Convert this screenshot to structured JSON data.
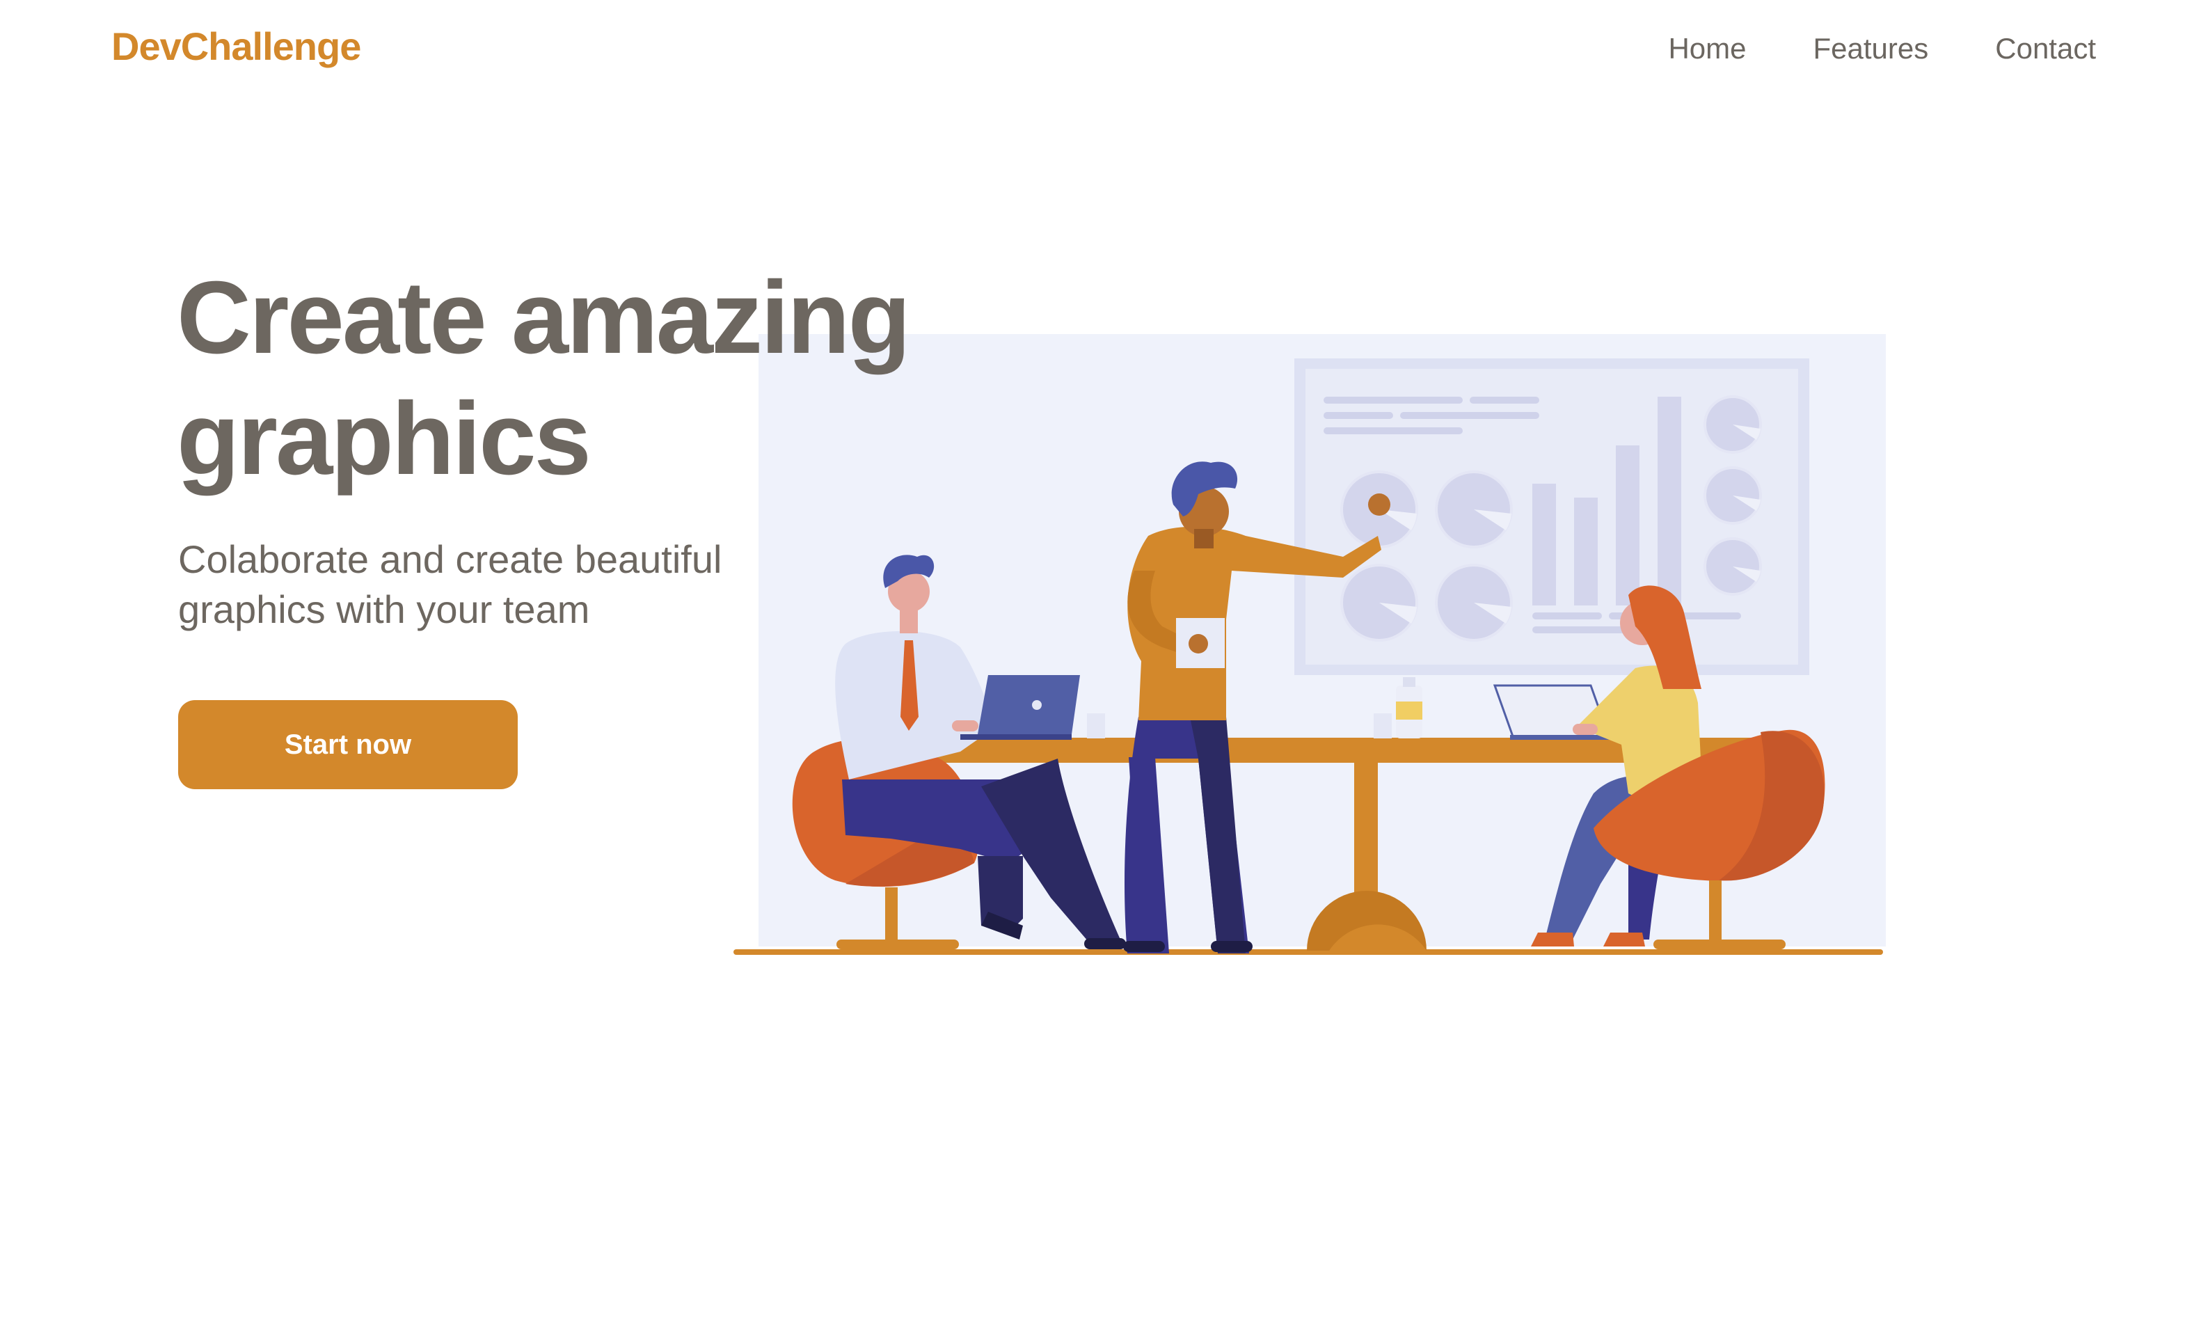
{
  "header": {
    "brand": "DevChallenge",
    "nav": [
      "Home",
      "Features",
      "Contact"
    ]
  },
  "hero": {
    "title": "Create amazing graphics",
    "subtitle": "Colaborate and create beautiful graphics with your team",
    "cta_label": "Start now"
  },
  "colors": {
    "accent": "#D3882B",
    "text": "#6d6760",
    "illustration_bg": "#EFF2FB"
  },
  "illustration": {
    "icon": "team-meeting-illustration"
  }
}
